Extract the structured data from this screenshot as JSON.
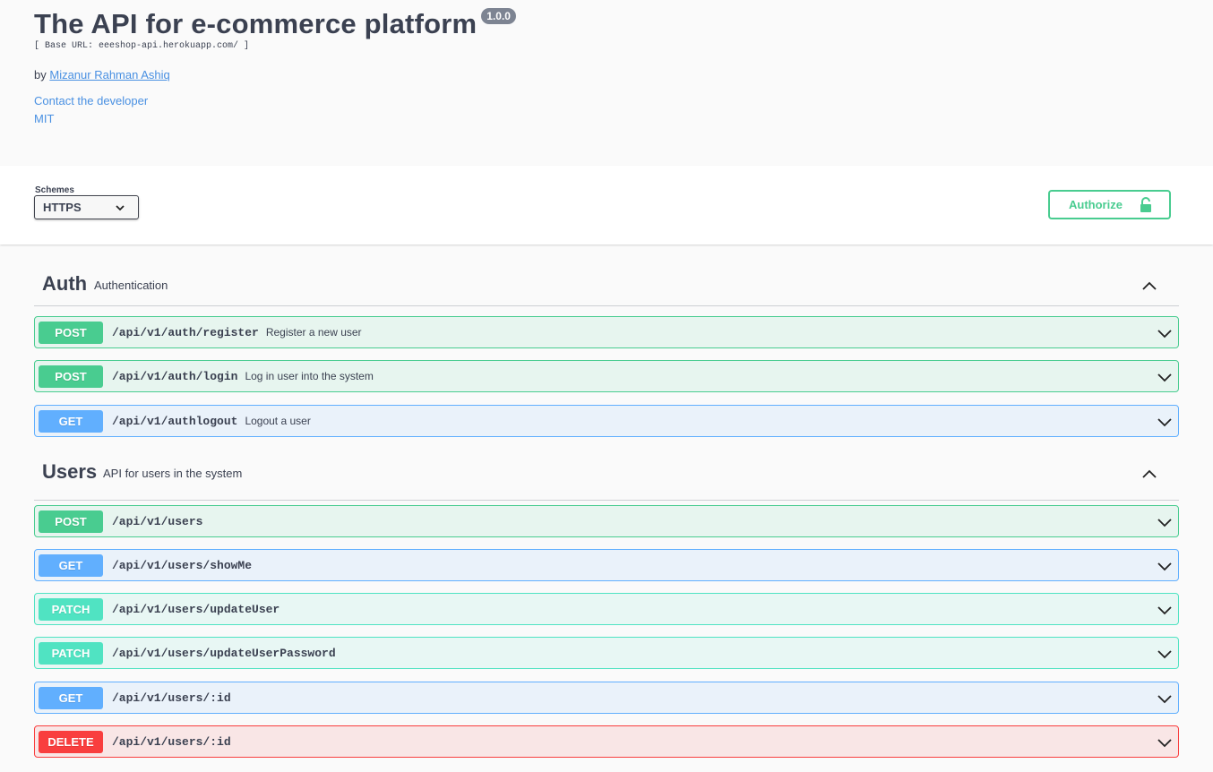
{
  "info": {
    "title": "The API for e-commerce platform",
    "version": "1.0.0",
    "base_url": "[ Base URL: eeeshop-api.herokuapp.com/ ]",
    "author_prefix": "by",
    "author_name": "Mizanur Rahman Ashiq",
    "contact": "Contact the developer",
    "license": "MIT"
  },
  "schemes": {
    "label": "Schemes",
    "selected": "HTTPS"
  },
  "authorize": {
    "label": "Authorize"
  },
  "colors": {
    "post": "#49cc90",
    "get": "#61affe",
    "patch": "#50e3c2",
    "delete": "#f93e3e",
    "link": "#4990e2"
  },
  "tags": [
    {
      "name": "Auth",
      "description": "Authentication",
      "operations": [
        {
          "method": "POST",
          "path": "/api/v1/auth/register",
          "summary": "Register a new user"
        },
        {
          "method": "POST",
          "path": "/api/v1/auth/login",
          "summary": "Log in user into the system"
        },
        {
          "method": "GET",
          "path": "/api/v1/authlogout",
          "summary": "Logout a user"
        }
      ]
    },
    {
      "name": "Users",
      "description": "API for users in the system",
      "operations": [
        {
          "method": "POST",
          "path": "/api/v1/users",
          "summary": ""
        },
        {
          "method": "GET",
          "path": "/api/v1/users/showMe",
          "summary": ""
        },
        {
          "method": "PATCH",
          "path": "/api/v1/users/updateUser",
          "summary": ""
        },
        {
          "method": "PATCH",
          "path": "/api/v1/users/updateUserPassword",
          "summary": ""
        },
        {
          "method": "GET",
          "path": "/api/v1/users/:id",
          "summary": ""
        },
        {
          "method": "DELETE",
          "path": "/api/v1/users/:id",
          "summary": ""
        }
      ]
    }
  ]
}
